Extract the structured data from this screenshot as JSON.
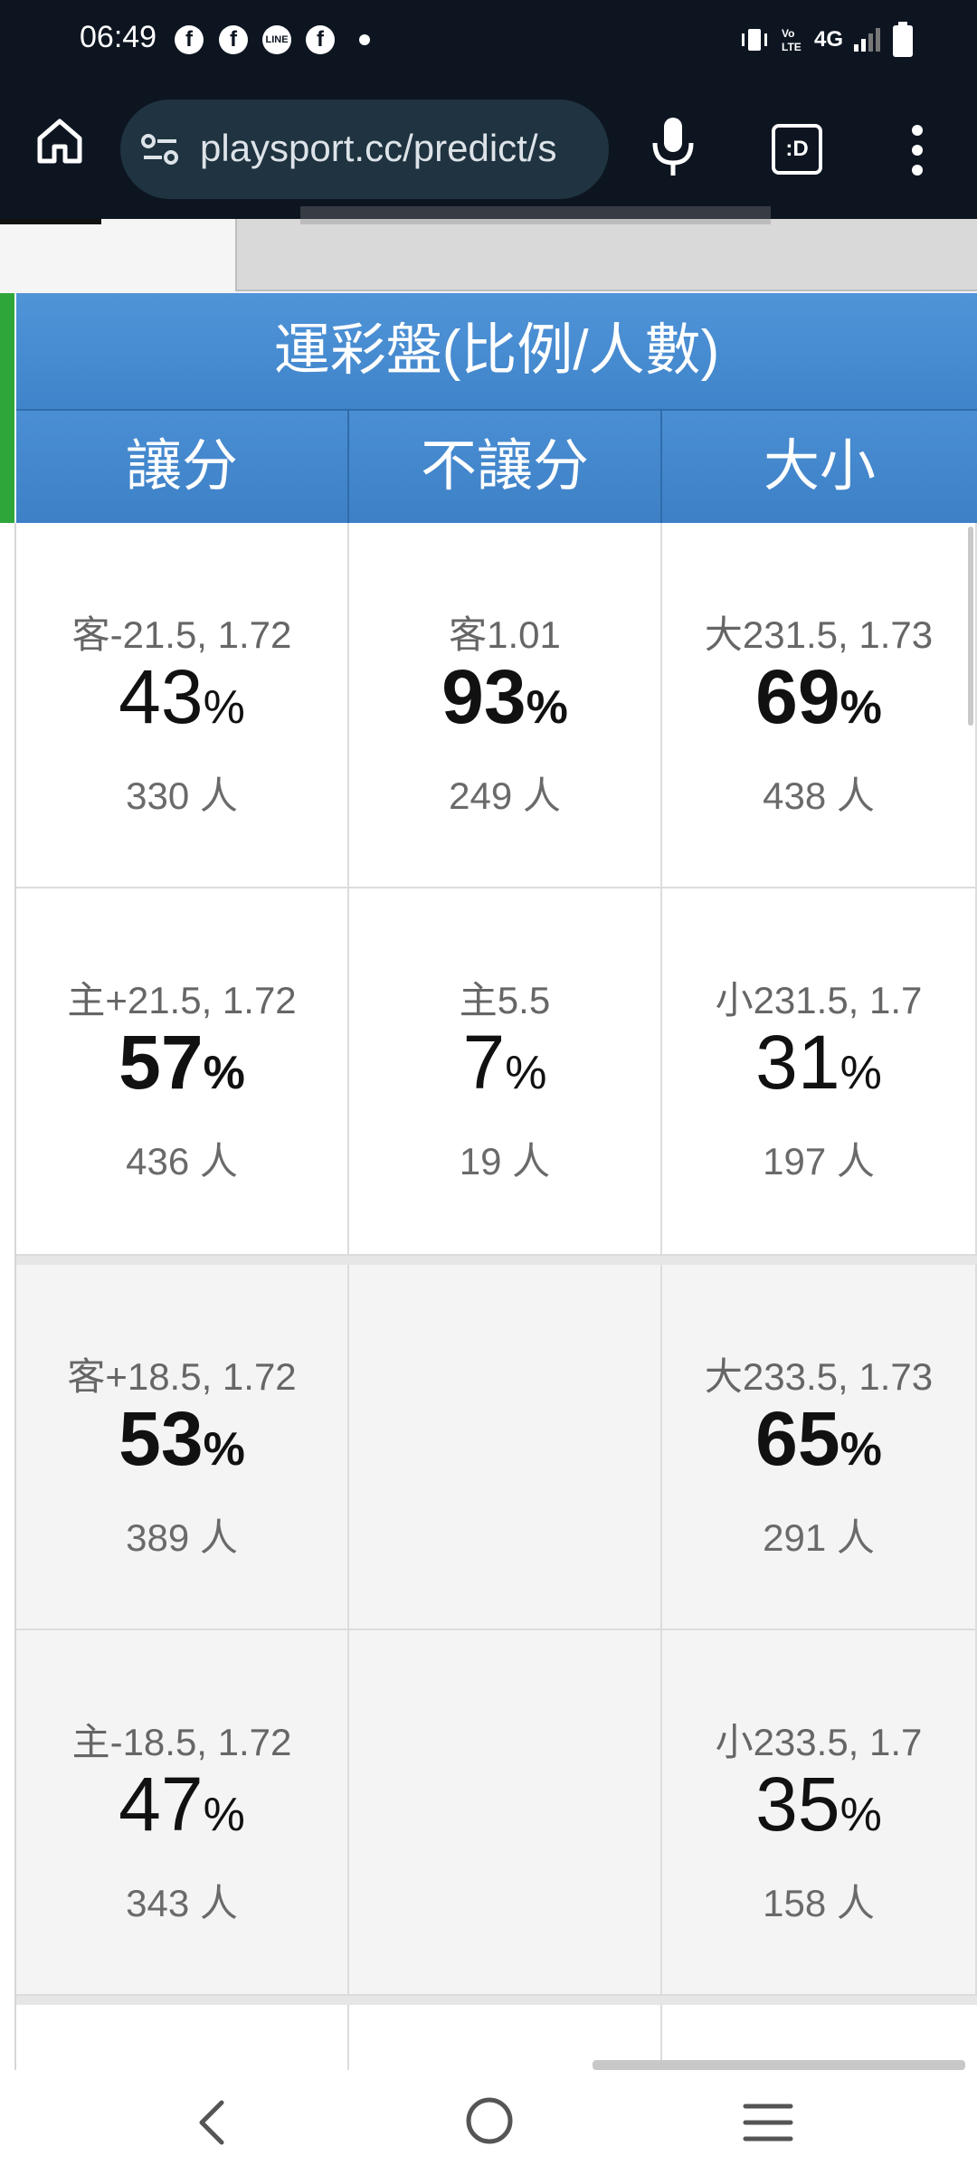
{
  "status_bar": {
    "time": "06:49",
    "notification_icons": [
      "facebook-icon",
      "facebook-icon",
      "line-icon",
      "facebook-icon"
    ],
    "network": "4G",
    "battery": "full"
  },
  "browser": {
    "url": "playsport.cc/predict/s"
  },
  "table": {
    "header_title": "運彩盤(比例/人數)",
    "columns": [
      "讓分",
      "不讓分",
      "大小"
    ],
    "rows": [
      {
        "cells": [
          {
            "odds": "客-21.5, 1.72",
            "pct": "43",
            "unit": "%",
            "count": "330 人",
            "bold": false
          },
          {
            "odds": "客1.01",
            "pct": "93",
            "unit": "%",
            "count": "249 人",
            "bold": true
          },
          {
            "odds": "大231.5, 1.73",
            "pct": "69",
            "unit": "%",
            "count": "438 人",
            "bold": true
          }
        ]
      },
      {
        "cells": [
          {
            "odds": "主+21.5, 1.72",
            "pct": "57",
            "unit": "%",
            "count": "436 人",
            "bold": true
          },
          {
            "odds": "主5.5",
            "pct": "7",
            "unit": "%",
            "count": "19 人",
            "bold": false
          },
          {
            "odds": "小231.5, 1.7",
            "pct": "31",
            "unit": "%",
            "count": "197 人",
            "bold": false
          }
        ]
      },
      {
        "cells": [
          {
            "odds": "客+18.5, 1.72",
            "pct": "53",
            "unit": "%",
            "count": "389 人",
            "bold": true
          },
          {
            "odds": "",
            "pct": "",
            "unit": "",
            "count": "",
            "bold": false
          },
          {
            "odds": "大233.5, 1.73",
            "pct": "65",
            "unit": "%",
            "count": "291 人",
            "bold": true
          }
        ]
      },
      {
        "cells": [
          {
            "odds": "主-18.5, 1.72",
            "pct": "47",
            "unit": "%",
            "count": "343 人",
            "bold": false
          },
          {
            "odds": "",
            "pct": "",
            "unit": "",
            "count": "",
            "bold": false
          },
          {
            "odds": "小233.5, 1.7",
            "pct": "35",
            "unit": "%",
            "count": "158 人",
            "bold": false
          }
        ]
      }
    ]
  },
  "colors": {
    "header_blue": "#4a8ed3",
    "status_bar_bg": "#0d1521",
    "url_pill_bg": "#1f3340"
  }
}
